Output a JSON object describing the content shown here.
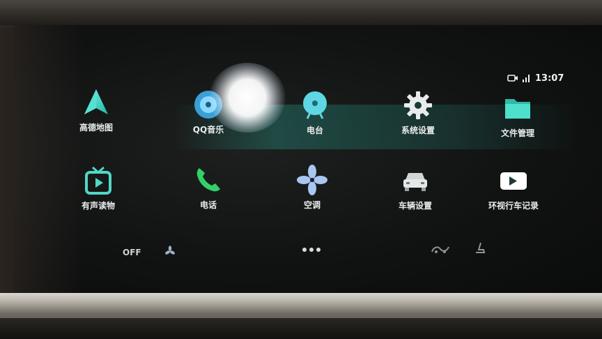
{
  "status_bar": {
    "time": "13:07",
    "icons": [
      "camera-icon",
      "signal-icon"
    ]
  },
  "apps": [
    {
      "id": "gaode-map",
      "label": "高德地图",
      "icon": "navigation-arrow-icon"
    },
    {
      "id": "qq-music",
      "label": "QQ音乐",
      "icon": "music-disc-icon"
    },
    {
      "id": "radio",
      "label": "电台",
      "icon": "radio-icon"
    },
    {
      "id": "system-settings",
      "label": "系统设置",
      "icon": "gear-icon"
    },
    {
      "id": "file-manager",
      "label": "文件管理",
      "icon": "folder-icon"
    },
    {
      "id": "audiobook",
      "label": "有声读物",
      "icon": "tv-play-icon"
    },
    {
      "id": "phone",
      "label": "电话",
      "icon": "phone-icon"
    },
    {
      "id": "air-conditioning",
      "label": "空调",
      "icon": "fan-icon"
    },
    {
      "id": "vehicle-settings",
      "label": "车辆设置",
      "icon": "car-icon"
    },
    {
      "id": "dashcam",
      "label": "环视行车记录",
      "icon": "video-camera-icon"
    }
  ],
  "dock": {
    "ac_state": "OFF",
    "items": [
      "fan-icon",
      "more-dots-icon",
      "seat-heat-icon",
      "seat-icon"
    ]
  },
  "colors": {
    "accent_teal": "#3fd3c4",
    "label_white": "#e9ecec"
  }
}
